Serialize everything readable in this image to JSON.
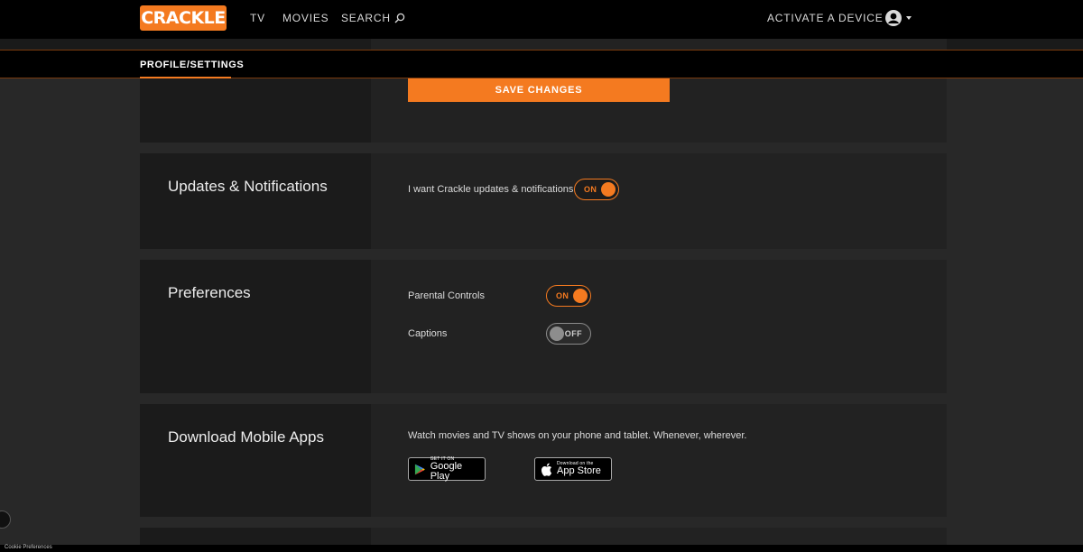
{
  "header": {
    "logo": "CRACKLE",
    "nav": {
      "tv": "TV",
      "movies": "MOVIES",
      "search": "SEARCH"
    },
    "activate": "ACTIVATE A DEVICE"
  },
  "subnav": {
    "active_tab": "PROFILE/SETTINGS"
  },
  "account": {
    "save_label": "SAVE CHANGES"
  },
  "updates": {
    "title": "Updates & Notifications",
    "label": "I want Crackle updates & notifications",
    "toggle": "ON"
  },
  "preferences": {
    "title": "Preferences",
    "parental_label": "Parental Controls",
    "parental_toggle": "ON",
    "captions_label": "Captions",
    "captions_toggle": "OFF"
  },
  "apps": {
    "title": "Download Mobile Apps",
    "description": "Watch movies and TV shows on your phone and tablet. Whenever, wherever.",
    "google_small": "GET IT ON",
    "google_big": "Google Play",
    "apple_small": "Download on the",
    "apple_big": "App Store"
  },
  "footer": {
    "cookie": "Cookie Preferences"
  },
  "colors": {
    "accent": "#f47a20",
    "background": "#282828",
    "panel": "#222222"
  }
}
